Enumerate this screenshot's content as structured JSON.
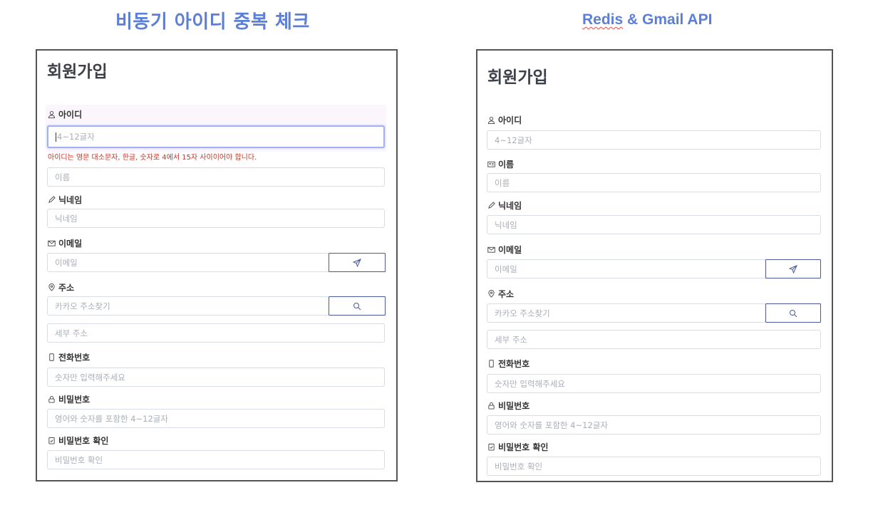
{
  "headings": {
    "left": "비동기 아이디 중복 체크",
    "right_underlined": "Redis",
    "right_rest": " & Gmail API"
  },
  "panels": {
    "left": {
      "title": "회원가입",
      "labels": {
        "id": "아이디",
        "nickname": "닉네임",
        "email": "이메일",
        "address": "주소",
        "phone": "전화번호",
        "password": "비밀번호",
        "password_confirm": "비밀번호 확인"
      },
      "fields": {
        "id": "4~12글자",
        "name": "이름",
        "nickname": "닉네임",
        "email": "이메일",
        "address": "카카오 주소찾기",
        "address_detail": "세부 주소",
        "phone": "숫자만 입력해주세요",
        "password": "영어와 숫자를 포함한 4~12글자",
        "password_confirm": "비밀번호 확인"
      },
      "id_error": "아이디는 영문 대소문자, 한글, 숫자로 4에서 15자 사이이어야 합니다."
    },
    "right": {
      "title": "회원가입",
      "labels": {
        "id": "아이디",
        "name": "이름",
        "nickname": "닉네임",
        "email": "이메일",
        "address": "주소",
        "phone": "전화번호",
        "password": "비밀번호",
        "password_confirm": "비밀번호 확인"
      },
      "fields": {
        "id": "4~12글자",
        "name": "이름",
        "nickname": "닉네임",
        "email": "이메일",
        "address": "카카오 주소찾기",
        "address_detail": "세부 주소",
        "phone": "숫자만 입력해주세요",
        "password": "영어와 숫자를 포함한 4~12글자",
        "password_confirm": "비밀번호 확인"
      }
    }
  },
  "icons": {
    "id": "user-icon",
    "name": "id-card-icon",
    "nickname": "pen-icon",
    "email": "envelope-icon",
    "address": "map-pin-icon",
    "phone": "phone-icon",
    "password": "lock-icon",
    "password_confirm": "clipboard-check-icon",
    "send_button": "send-icon",
    "search_button": "search-icon"
  },
  "colors": {
    "heading": "#5b7fd6",
    "error": "#c0392b",
    "focus_border": "#a4aef0",
    "button_border": "#4a5a9a"
  }
}
